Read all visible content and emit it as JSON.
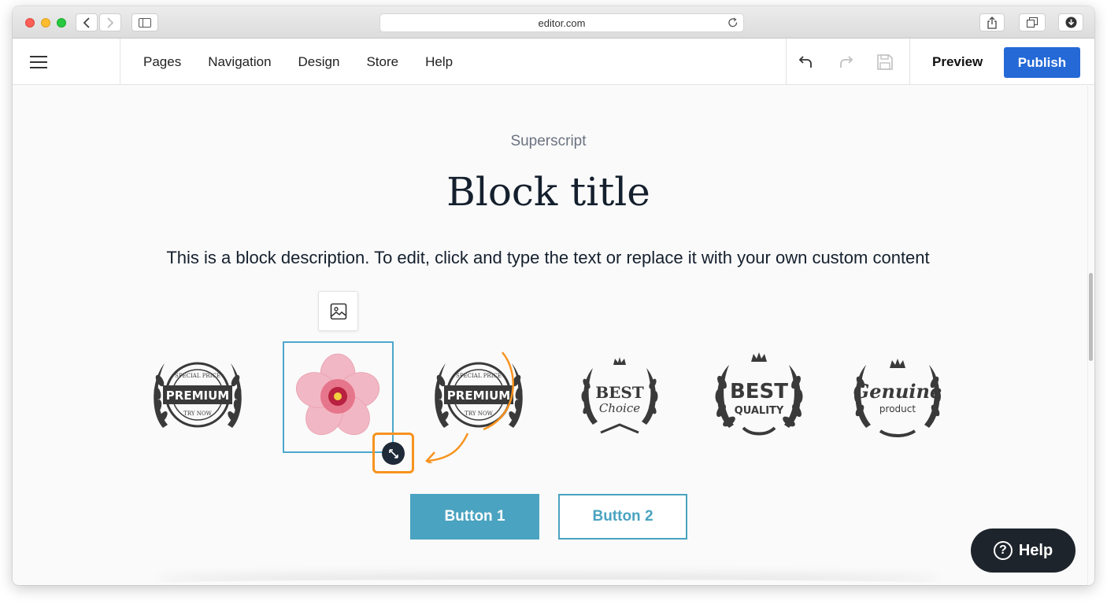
{
  "browser": {
    "url": "editor.com",
    "icons": [
      "back-icon",
      "forward-icon",
      "sidebar-icon",
      "reload-icon",
      "share-icon",
      "tabs-icon",
      "download-icon"
    ]
  },
  "toolbar": {
    "nav": [
      "Pages",
      "Navigation",
      "Design",
      "Store",
      "Help"
    ],
    "preview_label": "Preview",
    "publish_label": "Publish",
    "publish_color": "#2469d6"
  },
  "block": {
    "superscript": "Superscript",
    "title": "Block title",
    "description": "This is a block description. To edit, click and type the text or replace it with your own custom content",
    "logos": [
      {
        "name": "premium-badge",
        "lines": [
          "SPECIAL PRICE",
          "PREMIUM",
          "TRY NOW"
        ]
      },
      {
        "name": "flower-image",
        "selected": true
      },
      {
        "name": "premium-badge-2",
        "lines": [
          "SPECIAL PRICE",
          "PREMIUM",
          "TRY NOW"
        ]
      },
      {
        "name": "best-choice-badge",
        "lines": [
          "BEST",
          "Choice"
        ]
      },
      {
        "name": "best-quality-badge",
        "lines": [
          "BEST",
          "QUALITY"
        ]
      },
      {
        "name": "genuine-product-badge",
        "lines": [
          "Genuine",
          "product"
        ]
      }
    ],
    "button1_label": "Button 1",
    "button2_label": "Button 2",
    "accent_color": "#4aa3c0"
  },
  "help_button_label": "Help",
  "annotation_color": "#f7931e"
}
